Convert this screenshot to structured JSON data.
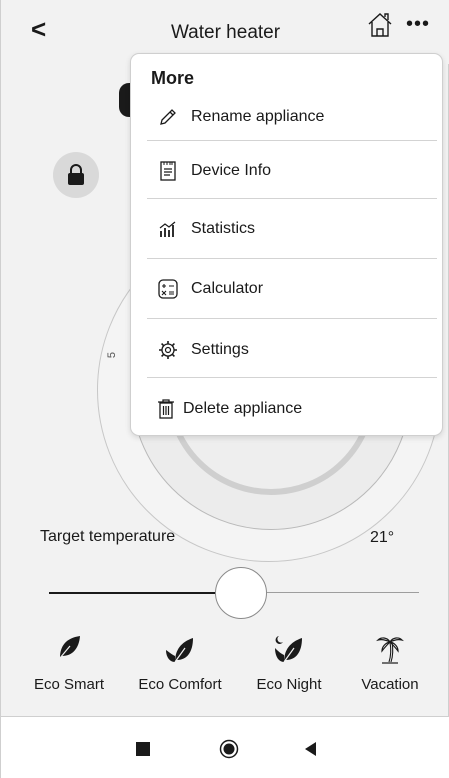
{
  "header": {
    "back_glyph": "<",
    "title": "Water heater",
    "home_icon": "home-icon",
    "more_glyph": "•••"
  },
  "dial": {
    "scale_label": "5"
  },
  "menu": {
    "title": "More",
    "items": [
      {
        "label": "Rename appliance",
        "icon": "pencil-icon"
      },
      {
        "label": "Device Info",
        "icon": "device-info-icon"
      },
      {
        "label": "Statistics",
        "icon": "statistics-icon"
      },
      {
        "label": "Calculator",
        "icon": "calculator-icon"
      },
      {
        "label": "Settings",
        "icon": "gear-icon"
      },
      {
        "label": "Delete appliance",
        "icon": "trash-icon"
      }
    ]
  },
  "temperature": {
    "label": "Target temperature",
    "value": "21°",
    "slider_fraction": 0.52
  },
  "modes": [
    {
      "label": "Eco Smart",
      "icon": "leaf-icon"
    },
    {
      "label": "Eco Comfort",
      "icon": "leaf-pot-icon"
    },
    {
      "label": "Eco Night",
      "icon": "leaf-moon-icon"
    },
    {
      "label": "Vacation",
      "icon": "palm-tree-icon"
    }
  ],
  "colors": {
    "background": "#f2f2f2",
    "text": "#1a1a1a",
    "menu_bg": "#ffffff"
  }
}
